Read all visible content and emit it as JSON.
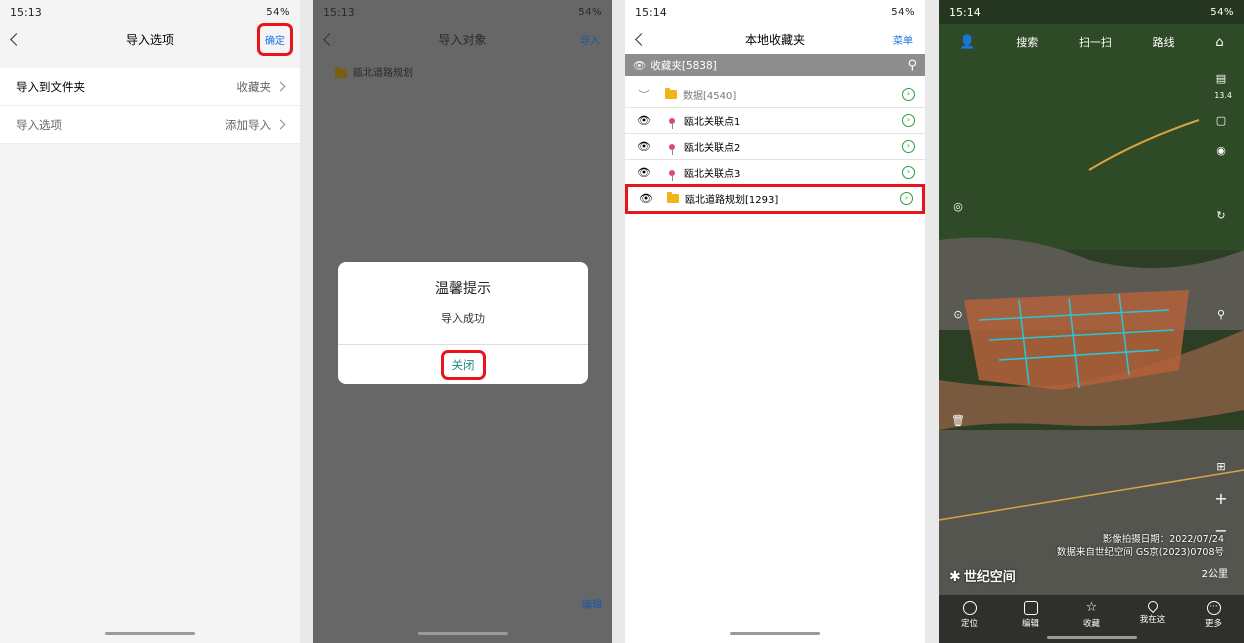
{
  "phone1": {
    "status": {
      "time": "15:13",
      "right": "54%"
    },
    "title": "导入选项",
    "confirm": "确定",
    "rows": [
      {
        "label": "导入到文件夹",
        "value": "收藏夹"
      },
      {
        "label": "导入选项",
        "value": "添加导入"
      }
    ]
  },
  "phone2": {
    "status": {
      "time": "15:13",
      "right": "54%"
    },
    "title": "导入对象",
    "import": "导入",
    "folder": "瓯北道路规划",
    "dialog": {
      "title": "温馨提示",
      "message": "导入成功",
      "close": "关闭"
    },
    "edit": "编辑"
  },
  "phone3": {
    "status": {
      "time": "15:14",
      "right": "54%"
    },
    "title": "本地收藏夹",
    "menu": "菜单",
    "search_label": "收藏夹[5838]",
    "rows": [
      {
        "name": "数据[4540]"
      },
      {
        "name": "瓯北关联点1"
      },
      {
        "name": "瓯北关联点2"
      },
      {
        "name": "瓯北关联点3"
      },
      {
        "name": "瓯北道路规划[1293]"
      }
    ]
  },
  "phone4": {
    "status": {
      "time": "15:14",
      "right": "54%"
    },
    "nav": {
      "search": "搜索",
      "scan": "扫一扫",
      "route": "路线"
    },
    "zoom": "13.4",
    "credit_date": "影像拍摄日期：2022/07/24",
    "credit_src": "数据来自世纪空间 GS京(2023)0708号",
    "brand": "世纪空间",
    "scale": "2公里",
    "bottom": [
      {
        "label": "定位"
      },
      {
        "label": "编辑"
      },
      {
        "label": "收藏"
      },
      {
        "label": "我在这"
      },
      {
        "label": "更多"
      }
    ]
  }
}
